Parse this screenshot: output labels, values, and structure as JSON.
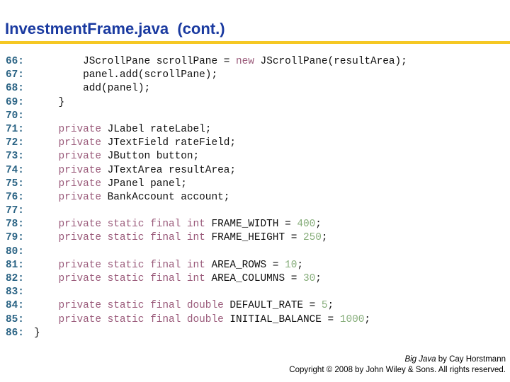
{
  "title": "InvestmentFrame.java  (cont.)",
  "colors": {
    "title": "#1a3aa0",
    "rule": "#f5c823",
    "line_number": "#2a6384",
    "keyword": "#9a5a7a",
    "number": "#86ad7a",
    "text": "#111111"
  },
  "code_lines": [
    {
      "num": "66:",
      "indent": "        ",
      "tokens": [
        {
          "t": "txt",
          "v": "JScrollPane scrollPane = "
        },
        {
          "t": "kw",
          "v": "new"
        },
        {
          "t": "txt",
          "v": " JScrollPane(resultArea);"
        }
      ]
    },
    {
      "num": "67:",
      "indent": "        ",
      "tokens": [
        {
          "t": "txt",
          "v": "panel.add(scrollPane);"
        }
      ]
    },
    {
      "num": "68:",
      "indent": "        ",
      "tokens": [
        {
          "t": "txt",
          "v": "add(panel);"
        }
      ]
    },
    {
      "num": "69:",
      "indent": "    ",
      "tokens": [
        {
          "t": "txt",
          "v": "}"
        }
      ]
    },
    {
      "num": "70:",
      "indent": "",
      "tokens": []
    },
    {
      "num": "71:",
      "indent": "    ",
      "tokens": [
        {
          "t": "kw",
          "v": "private"
        },
        {
          "t": "txt",
          "v": " JLabel rateLabel;"
        }
      ]
    },
    {
      "num": "72:",
      "indent": "    ",
      "tokens": [
        {
          "t": "kw",
          "v": "private"
        },
        {
          "t": "txt",
          "v": " JTextField rateField;"
        }
      ]
    },
    {
      "num": "73:",
      "indent": "    ",
      "tokens": [
        {
          "t": "kw",
          "v": "private"
        },
        {
          "t": "txt",
          "v": " JButton button;"
        }
      ]
    },
    {
      "num": "74:",
      "indent": "    ",
      "tokens": [
        {
          "t": "kw",
          "v": "private"
        },
        {
          "t": "txt",
          "v": " JTextArea resultArea;"
        }
      ]
    },
    {
      "num": "75:",
      "indent": "    ",
      "tokens": [
        {
          "t": "kw",
          "v": "private"
        },
        {
          "t": "txt",
          "v": " JPanel panel;"
        }
      ]
    },
    {
      "num": "76:",
      "indent": "    ",
      "tokens": [
        {
          "t": "kw",
          "v": "private"
        },
        {
          "t": "txt",
          "v": " BankAccount account;"
        }
      ]
    },
    {
      "num": "77:",
      "indent": "",
      "tokens": []
    },
    {
      "num": "78:",
      "indent": "    ",
      "tokens": [
        {
          "t": "kw",
          "v": "private static final int"
        },
        {
          "t": "txt",
          "v": " FRAME_WIDTH = "
        },
        {
          "t": "num",
          "v": "400"
        },
        {
          "t": "txt",
          "v": ";"
        }
      ]
    },
    {
      "num": "79:",
      "indent": "    ",
      "tokens": [
        {
          "t": "kw",
          "v": "private static final int"
        },
        {
          "t": "txt",
          "v": " FRAME_HEIGHT = "
        },
        {
          "t": "num",
          "v": "250"
        },
        {
          "t": "txt",
          "v": ";"
        }
      ]
    },
    {
      "num": "80:",
      "indent": "",
      "tokens": []
    },
    {
      "num": "81:",
      "indent": "    ",
      "tokens": [
        {
          "t": "kw",
          "v": "private static final int"
        },
        {
          "t": "txt",
          "v": " AREA_ROWS = "
        },
        {
          "t": "num",
          "v": "10"
        },
        {
          "t": "txt",
          "v": ";"
        }
      ]
    },
    {
      "num": "82:",
      "indent": "    ",
      "tokens": [
        {
          "t": "kw",
          "v": "private static final int"
        },
        {
          "t": "txt",
          "v": " AREA_COLUMNS = "
        },
        {
          "t": "num",
          "v": "30"
        },
        {
          "t": "txt",
          "v": ";"
        }
      ]
    },
    {
      "num": "83:",
      "indent": "",
      "tokens": []
    },
    {
      "num": "84:",
      "indent": "    ",
      "tokens": [
        {
          "t": "kw",
          "v": "private static final double"
        },
        {
          "t": "txt",
          "v": " DEFAULT_RATE = "
        },
        {
          "t": "num",
          "v": "5"
        },
        {
          "t": "txt",
          "v": ";"
        }
      ]
    },
    {
      "num": "85:",
      "indent": "    ",
      "tokens": [
        {
          "t": "kw",
          "v": "private static final double"
        },
        {
          "t": "txt",
          "v": " INITIAL_BALANCE = "
        },
        {
          "t": "num",
          "v": "1000"
        },
        {
          "t": "txt",
          "v": ";"
        }
      ]
    },
    {
      "num": "86:",
      "indent": "",
      "tokens": [
        {
          "t": "txt",
          "v": "}"
        }
      ]
    }
  ],
  "footer": {
    "book_title": "Big Java",
    "byline": " by Cay Horstmann",
    "copyright": "Copyright © 2008 by John Wiley & Sons.  All rights reserved."
  }
}
